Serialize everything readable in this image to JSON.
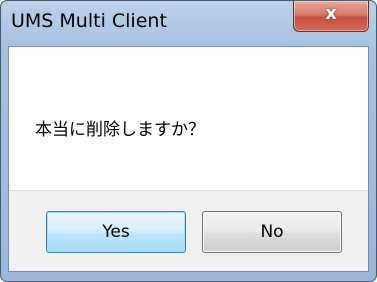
{
  "window": {
    "title": "UMS Multi Client",
    "close_label": "x"
  },
  "dialog": {
    "message": "本当に削除しますか？",
    "yes_label": "Yes",
    "no_label": "No"
  }
}
